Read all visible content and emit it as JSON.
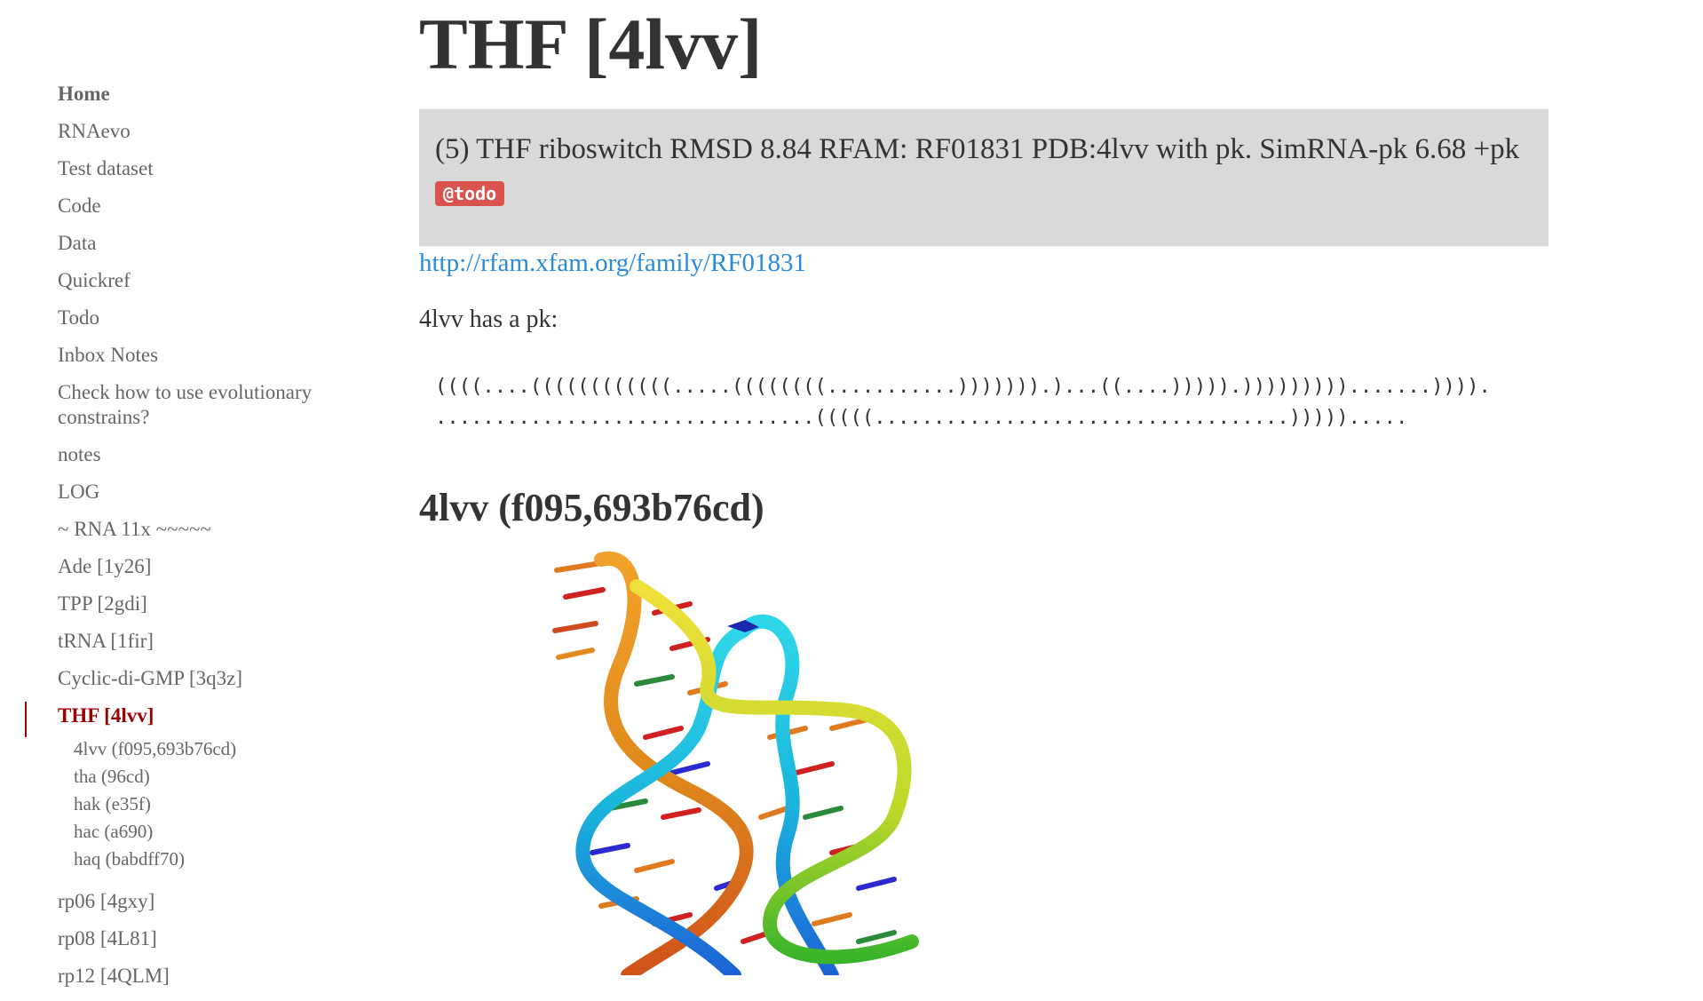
{
  "sidebar": {
    "items": [
      {
        "label": "Home"
      },
      {
        "label": "RNAevo"
      },
      {
        "label": "Test dataset"
      },
      {
        "label": "Code"
      },
      {
        "label": "Data"
      },
      {
        "label": "Quickref"
      },
      {
        "label": "Todo"
      },
      {
        "label": "Inbox Notes"
      },
      {
        "label": "Check how to use evolutionary constrains?"
      },
      {
        "label": "notes"
      },
      {
        "label": "LOG"
      },
      {
        "label": "~ RNA 11x ~~~~~"
      },
      {
        "label": "Ade [1y26]"
      },
      {
        "label": "TPP [2gdi]"
      },
      {
        "label": "tRNA [1fir]"
      },
      {
        "label": "Cyclic-di-GMP [3q3z]"
      },
      {
        "label": "THF [4lvv]"
      }
    ],
    "subitems": [
      {
        "label": "4lvv (f095,693b76cd)"
      },
      {
        "label": "tha (96cd)"
      },
      {
        "label": "hak (e35f)"
      },
      {
        "label": "hac (a690)"
      },
      {
        "label": "haq (babdff70)"
      }
    ],
    "after_items": [
      {
        "label": "rp06 [4gxy]"
      },
      {
        "label": "rp08 [4L81]"
      },
      {
        "label": "rp12 [4QLM]"
      }
    ]
  },
  "main": {
    "title": "THF [4lvv]",
    "callout_text": "(5) THF riboswitch RMSD 8.84 RFAM: RF01831 PDB:4lvv with pk. SimRNA-pk 6.68 +pk",
    "todo_tag": "@todo",
    "link": "http://rfam.xfam.org/family/RF01831",
    "pk_text": "4lvv has a pk:",
    "dotbracket_line1": "((((....((((((((((((.....((((((((...........))))))).)...((....))))).))))))))).......)))).",
    "dotbracket_line2": "................................(((((...................................))))).....",
    "section_heading": "4lvv (f095,693b76cd)"
  },
  "colors": {
    "active": "#990000",
    "link": "#2a8bd8",
    "callout_bg": "#d9d9d9",
    "todo_bg": "#d9534f",
    "nav_text": "#666666"
  }
}
